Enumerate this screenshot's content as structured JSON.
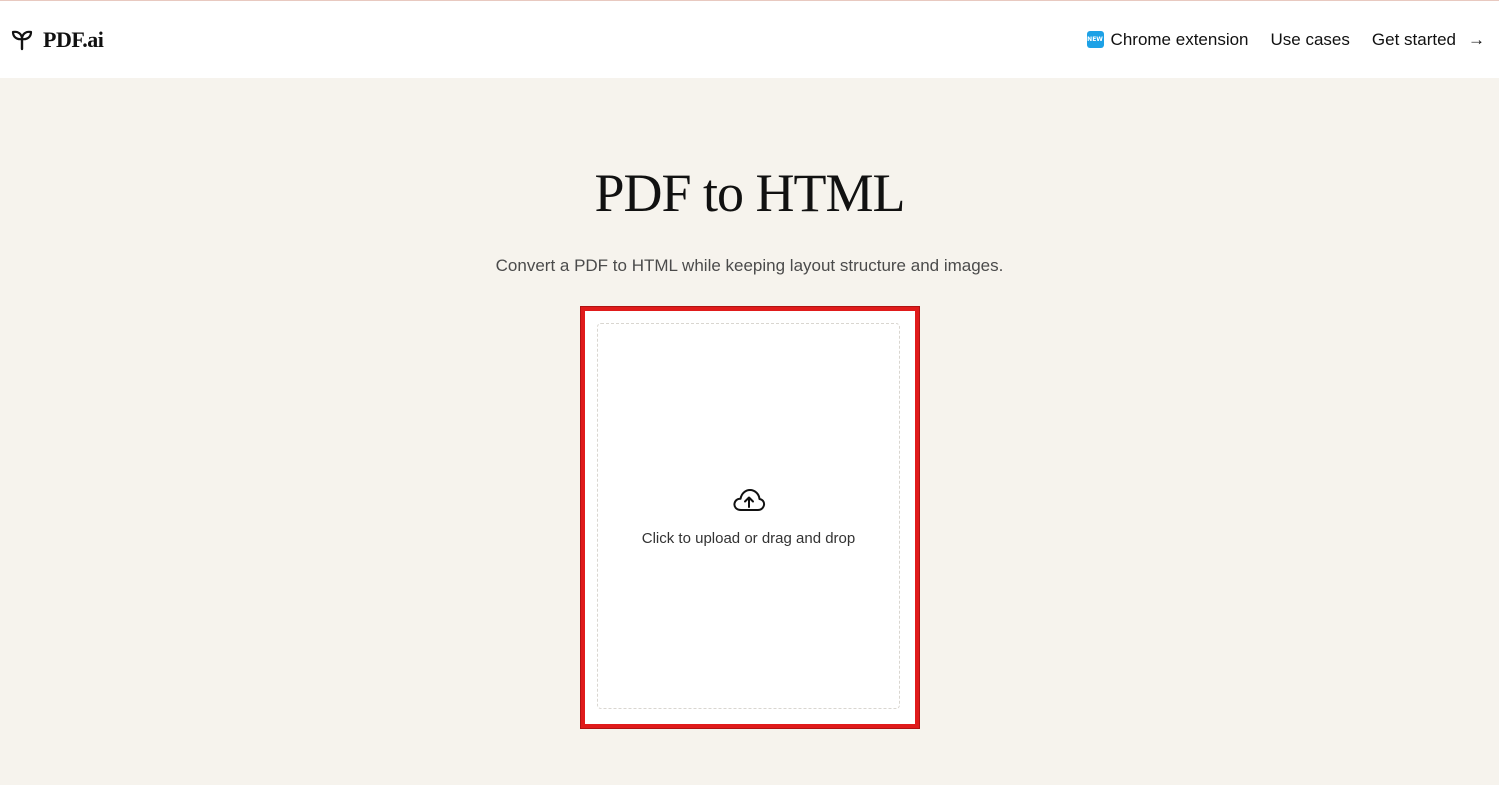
{
  "header": {
    "brand": "PDF.ai",
    "brand_icon": "sprout-icon",
    "nav": {
      "chrome_badge": "NEW",
      "chrome_extension": "Chrome extension",
      "use_cases": "Use cases",
      "get_started": "Get started",
      "get_started_arrow": "→"
    }
  },
  "main": {
    "title": "PDF to HTML",
    "subtitle": "Convert a PDF to HTML while keeping layout structure and images.",
    "upload": {
      "icon": "cloud-upload-icon",
      "text": "Click to upload or drag and drop"
    }
  },
  "colors": {
    "background": "#f6f3ed",
    "highlight_border": "#e01b1b",
    "badge": "#1da1e6"
  }
}
